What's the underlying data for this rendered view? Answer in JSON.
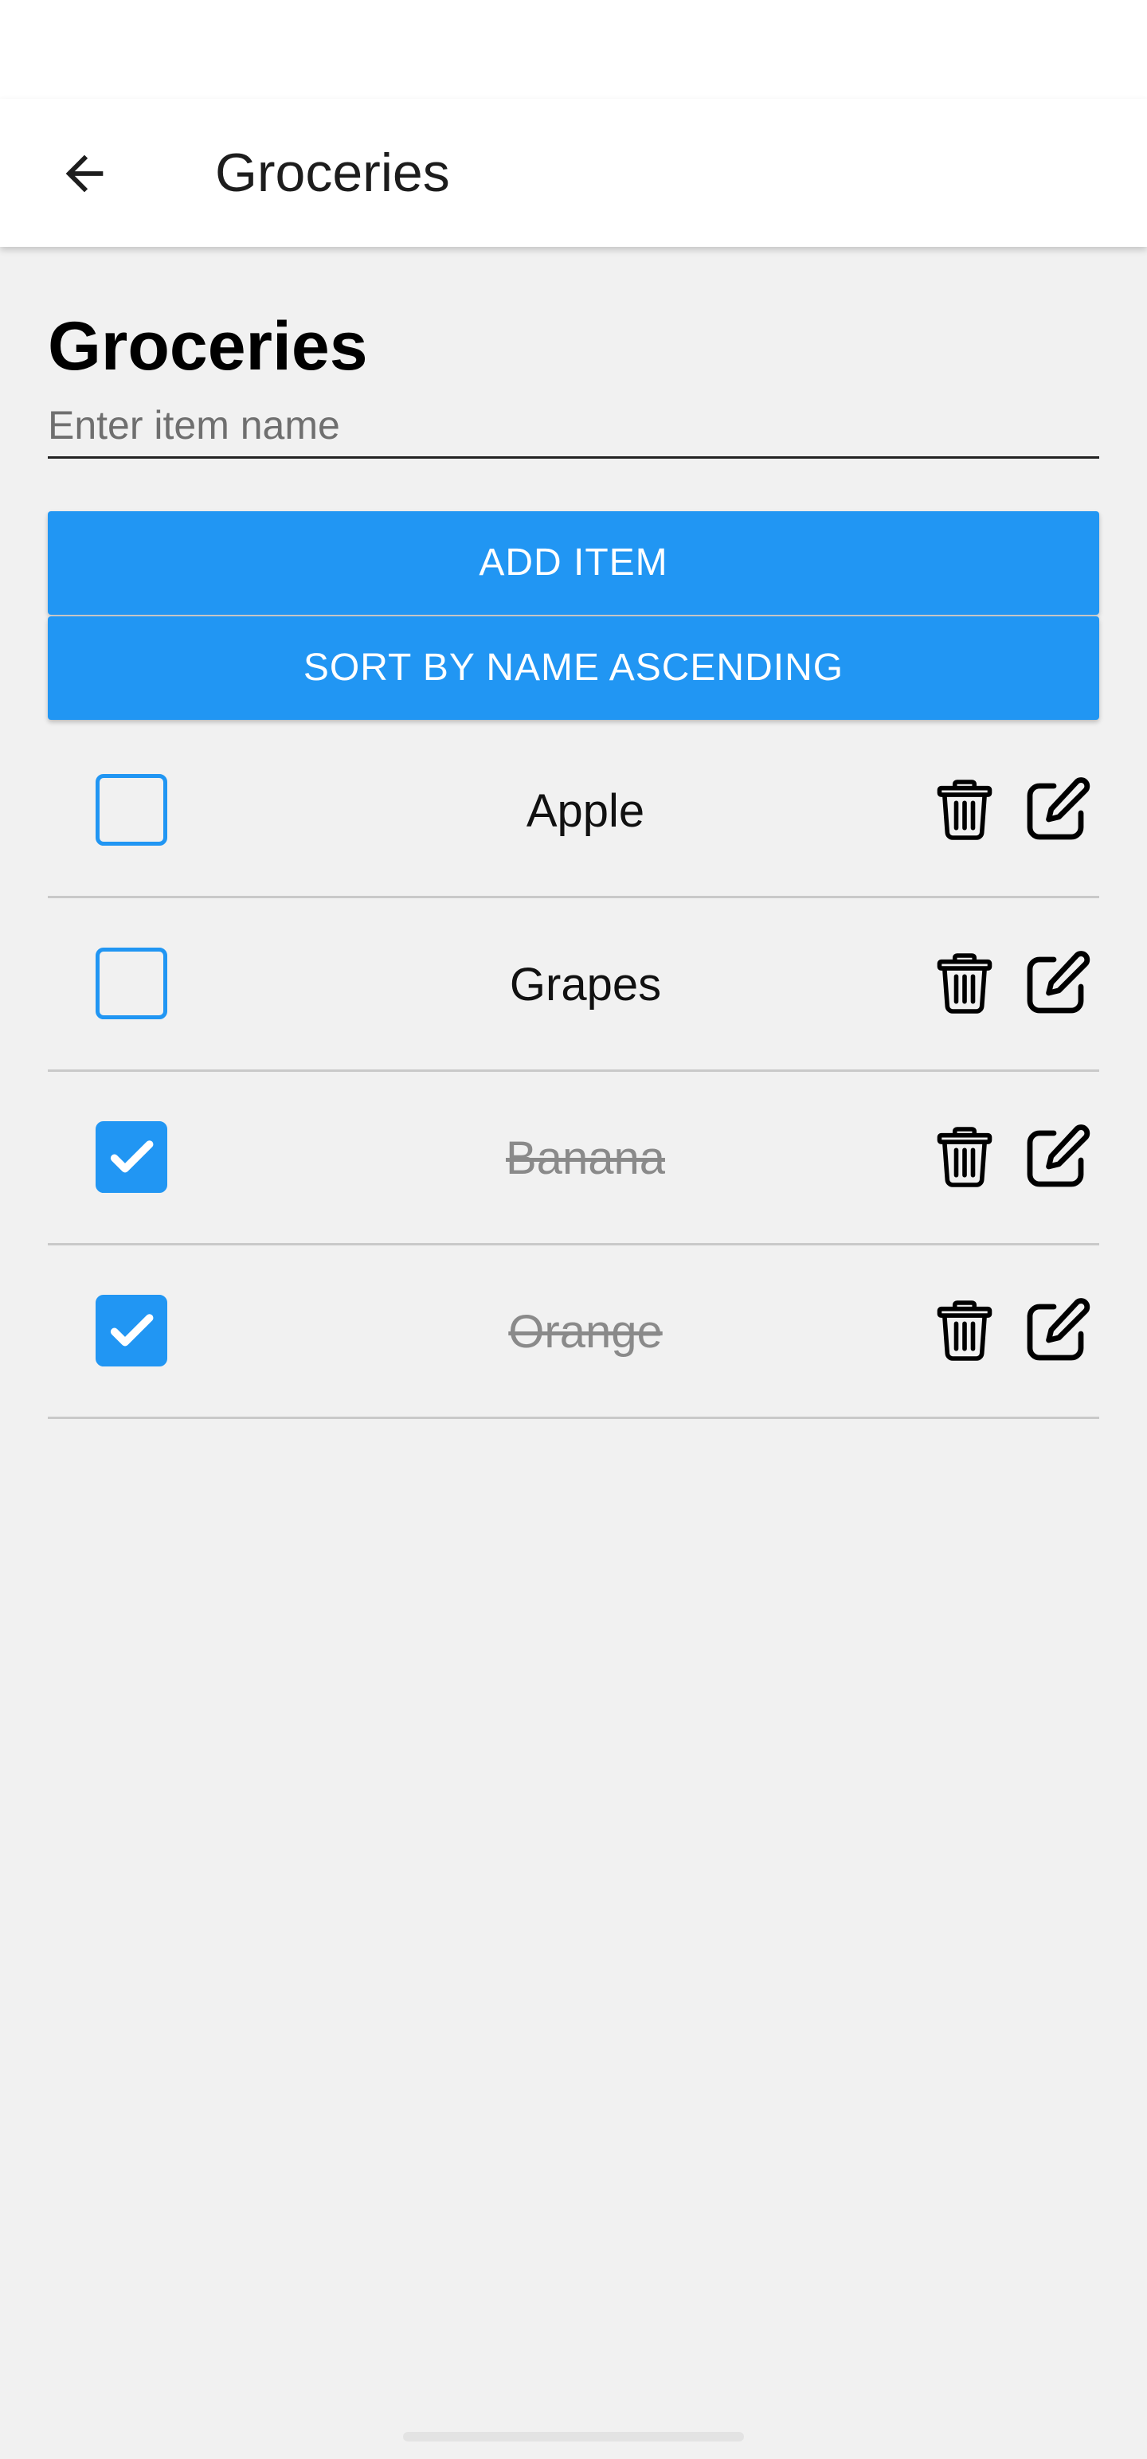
{
  "app_bar": {
    "title": "Groceries",
    "back_icon": "arrow-left-icon"
  },
  "main": {
    "heading": "Groceries",
    "input": {
      "placeholder": "Enter item name",
      "value": ""
    },
    "add_button_label": "ADD ITEM",
    "sort_button_label": "SORT BY NAME ASCENDING"
  },
  "items": [
    {
      "name": "Apple",
      "checked": false
    },
    {
      "name": "Grapes",
      "checked": false
    },
    {
      "name": "Banana",
      "checked": true
    },
    {
      "name": "Orange",
      "checked": true
    }
  ],
  "icons": {
    "delete": "trash-icon",
    "edit": "edit-icon",
    "check": "checkmark-icon"
  },
  "colors": {
    "accent": "#2196f3",
    "background": "#f1f1f1",
    "app_bar": "#ffffff",
    "completed_text": "#8a8a8a"
  }
}
